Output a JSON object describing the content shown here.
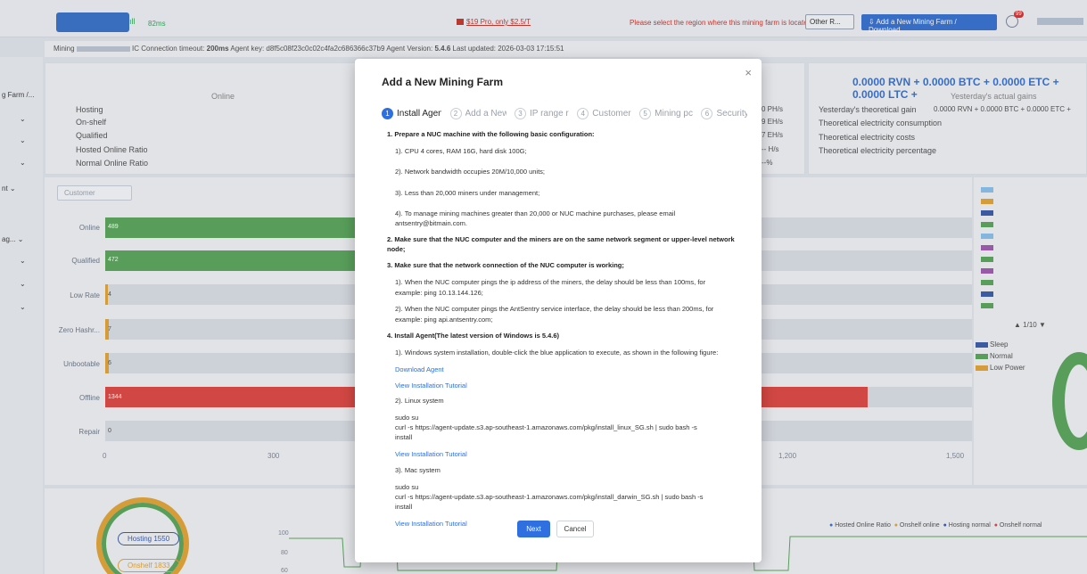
{
  "topbar": {
    "ping": "82ms",
    "promo": "$19 Pro, only $2.5/T",
    "region_message": "Please select the region where this mining farm is located:",
    "region_select_value": "Other R...",
    "add_farm_button": "Add a New Mining Farm / Download",
    "notification_count": "99"
  },
  "infobar": {
    "mining_label": "Mining",
    "connection_timeout_label": "IC Connection timeout:",
    "connection_timeout_value": "200ms",
    "agent_key_label": "Agent key:",
    "agent_key_value": "d8f5c08f23c0c02c4fa2c686366c37b9",
    "agent_version_label": "Agent Version:",
    "agent_version_value": "5.4.6",
    "last_updated_label": "Last updated:",
    "last_updated_value": "2026-03-03 17:15:51"
  },
  "sidebar": {
    "items": [
      "g Farm /...",
      "⌄",
      "⌄",
      "⌄",
      "nt ⌄",
      "ag... ⌄",
      "⌄",
      "⌄",
      "⌄"
    ]
  },
  "stats": {
    "online_label": "Online",
    "labels": [
      "Hosting",
      "On-shelf",
      "Qualified",
      "Hosted Online Ratio",
      "Normal Online Ratio"
    ],
    "values": [
      "0 PH/s",
      "9 EH/s",
      "7 EH/s",
      "-- H/s",
      "--%"
    ],
    "gain_summary": "0.0000 RVN + 0.0000 BTC + 0.0000 ETC + 0.0000 LTC +",
    "actual_gain_label": "Yesterday's actual gains",
    "right_labels": [
      "Yesterday's theoretical gain",
      "Theoretical electricity consumption",
      "Theoretical electricity costs",
      "Theoretical electricity percentage"
    ],
    "theoretical_gain_value": "0.0000 RVN + 0.0000 BTC + 0.0000 ETC +"
  },
  "customer_select_placeholder": "Customer",
  "bars": {
    "labels": [
      "Online",
      "Qualified",
      "Low Rate",
      "Zero Hashr...",
      "Unbootable",
      "Offline",
      "Repair"
    ],
    "values": [
      "489",
      "472",
      "4",
      "7",
      "6",
      "1344",
      "0"
    ],
    "axis_ticks": [
      "0",
      "300",
      "1,200",
      "1,500"
    ]
  },
  "legend": {
    "page": "1/10",
    "status_items": [
      "Sleep",
      "Normal",
      "Low Power"
    ]
  },
  "bottom": {
    "hosting_pill": "Hosting 1550",
    "onshelf_pill": "Onshelf 1833",
    "y_ticks": [
      "100",
      "80",
      "60"
    ],
    "line_legend": [
      "Hosted Online Ratio",
      "Onshelf online",
      "Hosting normal",
      "Onshelf normal"
    ]
  },
  "modal": {
    "title": "Add a New Mining Farm",
    "close_symbol": "×",
    "steps": [
      {
        "num": "1",
        "label": "Install Agent"
      },
      {
        "num": "2",
        "label": "Add a New"
      },
      {
        "num": "3",
        "label": "IP range r"
      },
      {
        "num": "4",
        "label": "Customer"
      },
      {
        "num": "5",
        "label": "Mining pc"
      },
      {
        "num": "6",
        "label": "Security Settings"
      }
    ],
    "lines": [
      "1. Prepare a NUC machine with the following basic configuration:",
      "1). CPU 4 cores, RAM 16G, hard disk 100G;",
      "2). Network bandwidth occupies 20M/10,000 units;",
      "3). Less than 20,000 miners under management;",
      "4). To manage mining machines greater than 20,000 or NUC machine purchases, please email",
      "antsentry@bitmain.com.",
      "2. Make sure that the NUC computer and the miners are on the same network segment or upper-level network",
      "node;",
      "3. Make sure that the network connection of the NUC computer is working;",
      "1). When the NUC computer pings the ip address of the miners, the delay should be less than 100ms, for",
      "example: ping 10.13.144.126;",
      "2). When the NUC computer pings the AntSentry service interface, the delay should be less than 200ms, for",
      "example: ping api.antsentry.com;",
      "4. Install Agent(The latest version of Windows is 5.4.6)",
      "1). Windows system installation, double-click the blue application to execute, as shown in the following figure:",
      "Download Agent",
      "View Installation Tutorial",
      "2). Linux system",
      "sudo su",
      "curl -s https://agent-update.s3.ap-southeast-1.amazonaws.com/pkg/install_linux_SG.sh | sudo bash -s",
      "install",
      "View Installation Tutorial",
      "3). Mac system",
      "sudo su",
      "curl -s https://agent-update.s3.ap-southeast-1.amazonaws.com/pkg/install_darwin_SG.sh | sudo bash -s",
      "install",
      "View Installation Tutorial"
    ],
    "next_button": "Next",
    "cancel_button": "Cancel"
  }
}
